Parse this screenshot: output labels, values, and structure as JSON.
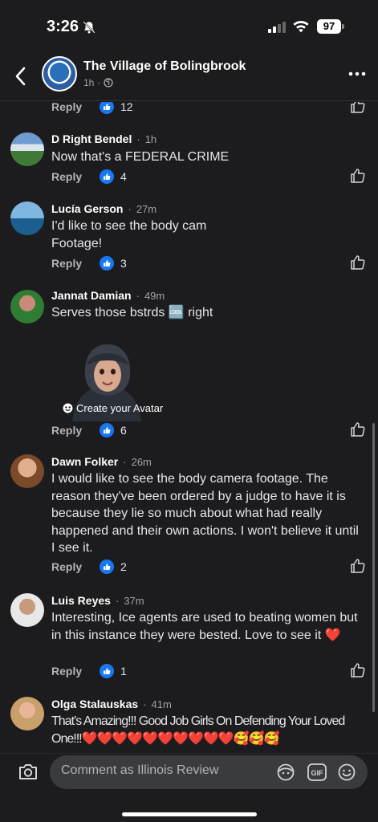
{
  "status": {
    "time": "3:26",
    "battery": "97"
  },
  "header": {
    "page_name": "The Village of Bolingbrook",
    "post_age": "1h",
    "separator": "·"
  },
  "comments": [
    {
      "author": "",
      "time": "",
      "text": "",
      "reply_label": "Reply",
      "likes": "12"
    },
    {
      "author": "D Right Bendel",
      "time": "1h",
      "text": "Now that's a FEDERAL CRIME",
      "reply_label": "Reply",
      "likes": "4"
    },
    {
      "author": "Lucía Gerson",
      "time": "27m",
      "text": "I'd like to see the body cam\nFootage!",
      "reply_label": "Reply",
      "likes": "3"
    },
    {
      "author": "Jannat Damian",
      "time": "49m",
      "text": "Serves those bstrds 🆒 right",
      "reply_label": "Reply",
      "likes": "6",
      "sticker_label": "Create your Avatar"
    },
    {
      "author": "Dawn Folker",
      "time": "26m",
      "text": "I would like to see the body camera footage. The reason they've been ordered by a judge to have it is because they lie so much about what had really happened and their own actions. I won't believe it until I see it.",
      "reply_label": "Reply",
      "likes": "2"
    },
    {
      "author": "Luis Reyes",
      "time": "37m",
      "text": "Interesting, Ice agents are used to beating women but in this instance they were bested. Love to see it ❤️",
      "reply_label": "Reply",
      "likes": "1"
    },
    {
      "author": "Olga Stalauskas",
      "time": "41m",
      "text": "That’s Amazing!!! Good Job Girls On Defending Your Loved One!!!❤️❤️❤️❤️❤️❤️❤️❤️❤️❤️🥰🥰🥰",
      "reply_label": "",
      "likes": ""
    }
  ],
  "composer": {
    "placeholder": "Comment as Illinois Review"
  },
  "colors": {
    "background": "#1c1c1e",
    "like_blue": "#1877f2",
    "muted": "#b0b3b8"
  },
  "icons": [
    "bell-slash-icon",
    "signal-icon",
    "wifi-icon",
    "battery-icon",
    "back-chevron-icon",
    "globe-icon",
    "more-icon",
    "like-icon",
    "thumbs-up-outline-icon",
    "camera-icon",
    "avatar-sticker-icon",
    "gif-icon",
    "emoji-icon"
  ]
}
